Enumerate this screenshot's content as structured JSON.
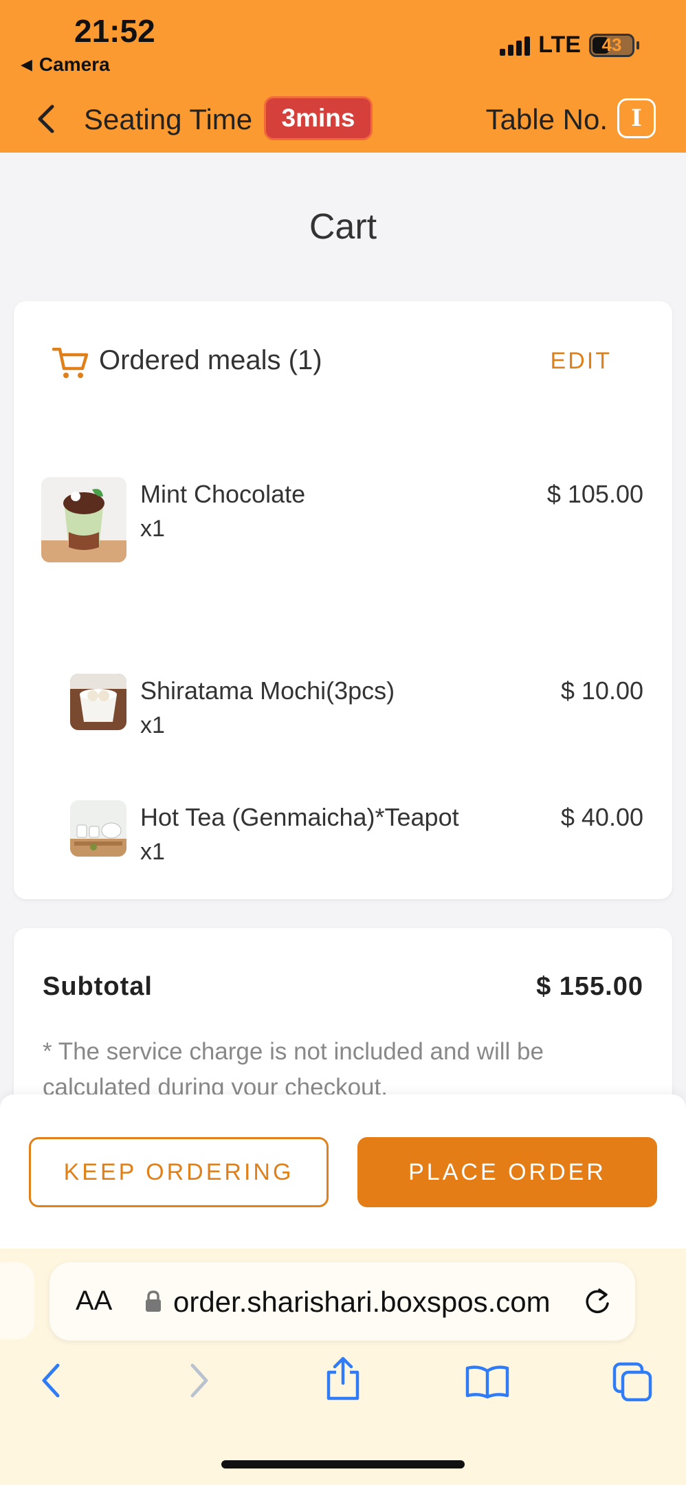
{
  "status_bar": {
    "time": "21:52",
    "back_app": "Camera",
    "network": "LTE",
    "battery": "43"
  },
  "app_bar": {
    "seating_label": "Seating Time",
    "seating_value": "3mins",
    "table_label": "Table No.",
    "table_value": "I"
  },
  "page": {
    "title": "Cart"
  },
  "meals": {
    "header": "Ordered meals (1)",
    "edit_label": "EDIT",
    "items": [
      {
        "name": "Mint Chocolate",
        "qty": "x1",
        "price": "$ 105.00"
      },
      {
        "name": "Shiratama Mochi(3pcs)",
        "qty": "x1",
        "price": "$ 10.00"
      },
      {
        "name": "Hot Tea (Genmaicha)*Teapot",
        "qty": "x1",
        "price": "$ 40.00"
      }
    ]
  },
  "summary": {
    "subtotal_label": "Subtotal",
    "subtotal_value": "$ 155.00",
    "note": "* The service charge is not included and will be calculated during your checkout."
  },
  "actions": {
    "keep_ordering": "KEEP ORDERING",
    "place_order": "PLACE ORDER"
  },
  "browser": {
    "aa_label": "AA",
    "url": "order.sharishari.boxspos.com"
  },
  "colors": {
    "header_bg": "#fb9a30",
    "accent": "#e47d16",
    "badge_red": "#d6403a"
  }
}
